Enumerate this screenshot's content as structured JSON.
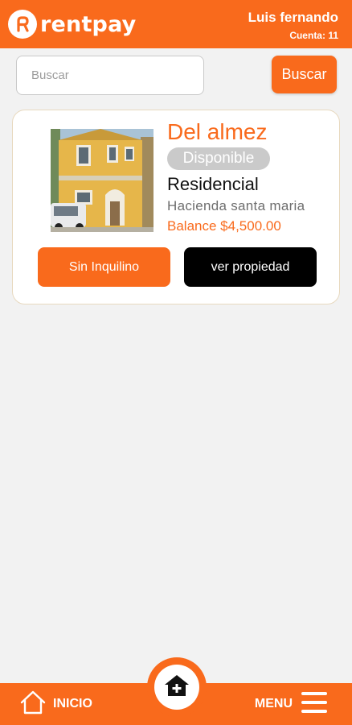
{
  "brand": {
    "name": "rentpay"
  },
  "user": {
    "name": "Luis fernando",
    "account": "Cuenta: 11"
  },
  "search": {
    "placeholder": "Buscar",
    "value": "",
    "button_label": "Buscar"
  },
  "property": {
    "name": "Del almez",
    "status": "Disponible",
    "type": "Residencial",
    "location": "Hacienda santa maria",
    "balance": "Balance $4,500.00",
    "tenant_button": "Sin Inquilino",
    "view_button": "ver propiedad"
  },
  "bottom_nav": {
    "home_label": "INICIO",
    "menu_label": "MENU"
  },
  "icons": {
    "logo": "rentpay-logo-icon",
    "home": "home-icon",
    "menu": "hamburger-menu-icon",
    "add_property": "add-property-icon"
  },
  "colors": {
    "accent": "#f96a1c",
    "badge": "#cacaca",
    "dark": "#000000"
  }
}
